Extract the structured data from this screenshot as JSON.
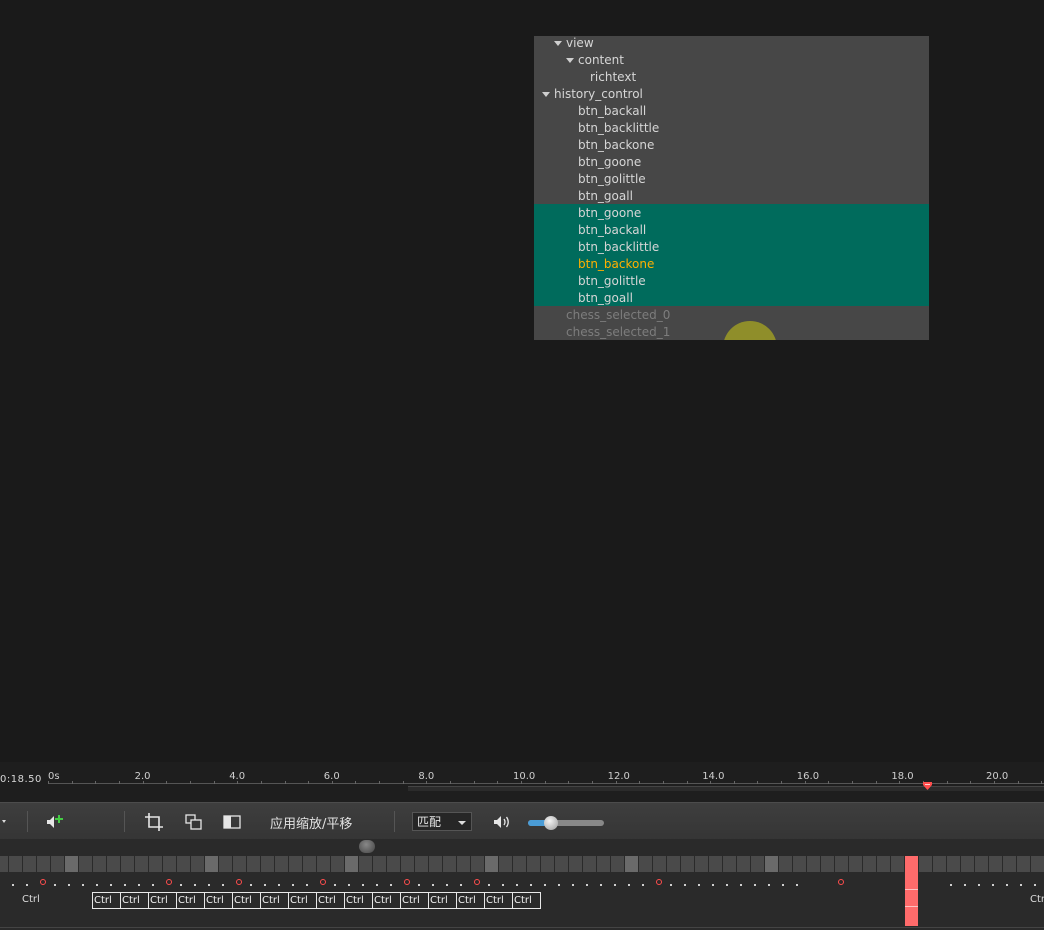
{
  "preview": {
    "tree": [
      {
        "label": "view",
        "depth": 2,
        "expanded": true
      },
      {
        "label": "content",
        "depth": 3,
        "expanded": true
      },
      {
        "label": "richtext",
        "depth": 4
      },
      {
        "label": "history_control",
        "depth": 1,
        "expanded": true
      },
      {
        "label": "btn_backall",
        "depth": 3
      },
      {
        "label": "btn_backlittle",
        "depth": 3
      },
      {
        "label": "btn_backone",
        "depth": 3
      },
      {
        "label": "btn_goone",
        "depth": 3
      },
      {
        "label": "btn_golittle",
        "depth": 3
      },
      {
        "label": "btn_goall",
        "depth": 3
      },
      {
        "label": "btn_goone",
        "depth": 3,
        "selected": true
      },
      {
        "label": "btn_backall",
        "depth": 3,
        "selected": true
      },
      {
        "label": "btn_backlittle",
        "depth": 3,
        "selected": true
      },
      {
        "label": "btn_backone",
        "depth": 3,
        "selected": true,
        "active": true
      },
      {
        "label": "btn_golittle",
        "depth": 3,
        "selected": true
      },
      {
        "label": "btn_goall",
        "depth": 3,
        "selected": true
      },
      {
        "label": "chess_selected_0",
        "depth": 2,
        "dim": true
      },
      {
        "label": "chess_selected_1",
        "depth": 2,
        "dim": true
      }
    ],
    "colors": {
      "selection": "#006b5c",
      "active_text": "#ffb000",
      "panel": "#474747"
    }
  },
  "ruler": {
    "timecode": "0:18.50",
    "ticks": [
      "0s",
      "2.0",
      "4.0",
      "6.0",
      "8.0",
      "10.0",
      "12.0",
      "14.0",
      "16.0",
      "18.0",
      "20.0"
    ],
    "playhead_position": 18.5
  },
  "toolbar": {
    "apply_label": "应用缩放/平移",
    "fit_select": "匹配",
    "volume": 0.3
  },
  "tracks": {
    "left_label": "Ctrl",
    "right_label": "Ctr",
    "ctrl_boxes": [
      "Ctrl",
      "Ctrl",
      "Ctrl",
      "Ctrl",
      "Ctrl",
      "Ctrl",
      "Ctrl",
      "Ctrl",
      "Ctrl",
      "Ctrl",
      "Ctrl",
      "Ctrl",
      "Ctrl",
      "Ctrl",
      "Ctrl",
      "Ctrl"
    ],
    "marker_color": "#ff6b6b"
  }
}
